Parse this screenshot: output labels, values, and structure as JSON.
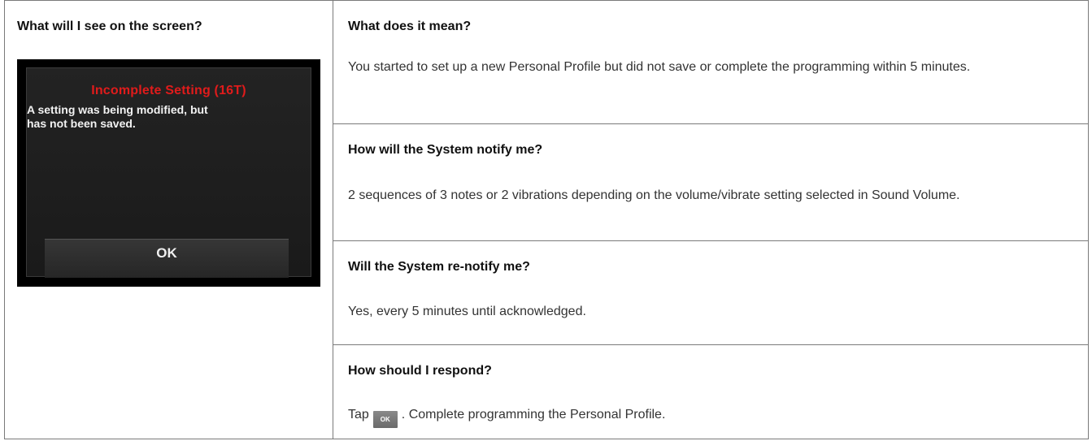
{
  "left": {
    "heading": "What will I see on the screen?",
    "screen": {
      "title": "Incomplete Setting (16T)",
      "message": "A setting was being modified, but\nhas not been saved.",
      "button_label": "OK",
      "title_color": "#e01b1b"
    }
  },
  "rows": [
    {
      "question": "What does it mean?",
      "answer": "You started to set up a new Personal Profile but did not save or complete the programming within 5 minutes."
    },
    {
      "question": "How will the System notify me?",
      "answer": "2 sequences of 3 notes or 2 vibrations depending on the volume/vibrate setting selected in Sound Volume."
    },
    {
      "question": "Will the System re-notify me?",
      "answer": "Yes, every 5 minutes until acknowledged."
    },
    {
      "question": "How should I respond?",
      "answer_prefix": "Tap",
      "inline_button_label": "OK",
      "answer_suffix": ". Complete programming the Personal Profile."
    }
  ]
}
